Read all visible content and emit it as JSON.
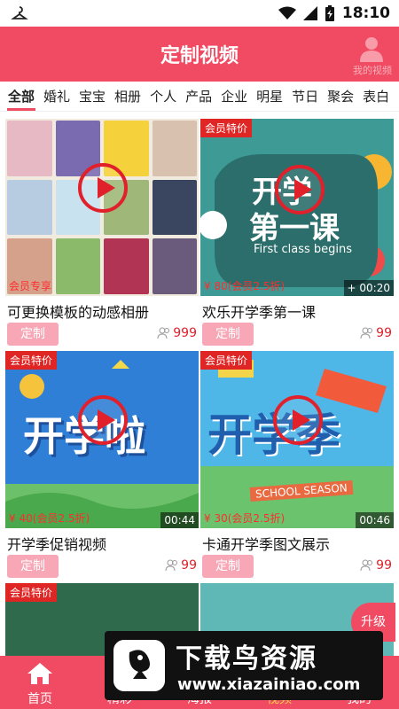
{
  "status_bar": {
    "time": "18:10"
  },
  "header": {
    "title": "定制视频",
    "mine_label": "我的视频"
  },
  "tabs": [
    "全部",
    "婚礼",
    "宝宝",
    "相册",
    "个人",
    "产品",
    "企业",
    "明星",
    "节日",
    "聚会",
    "表白"
  ],
  "cards": [
    {
      "title": "可更换模板的动感相册",
      "price": "会员专享",
      "make_label": "定制",
      "likes": "999",
      "badge": "",
      "duration": ""
    },
    {
      "title": "欢乐开学季第一课",
      "price": "¥ 80(会员2.5折)",
      "make_label": "定制",
      "likes": "99",
      "badge": "会员特价",
      "duration": "00:20",
      "thumb_text1": "开学",
      "thumb_text2": "第一课",
      "thumb_text3": "First class begins"
    },
    {
      "title": "开学季促销视频",
      "price": "¥ 40(会员2.5折)",
      "make_label": "定制",
      "likes": "99",
      "badge": "会员特价",
      "duration": "00:44",
      "thumb_text1": "开学啦"
    },
    {
      "title": "卡通开学季图文展示",
      "price": "¥ 30(会员2.5折)",
      "make_label": "定制",
      "likes": "99",
      "badge": "会员特价",
      "duration": "00:46",
      "thumb_text1": "开学季",
      "thumb_text2": "SCHOOL SEASON"
    },
    {
      "badge": "会员特价"
    }
  ],
  "upgrade_label": "升级",
  "bottom_nav": [
    {
      "label": "首页",
      "icon": "home-icon"
    },
    {
      "label": "精彩",
      "icon": "star-icon"
    },
    {
      "label": "海报",
      "icon": "image-icon"
    },
    {
      "label": "视频",
      "icon": "video-icon"
    },
    {
      "label": "我的",
      "icon": "user-icon"
    }
  ],
  "watermark": {
    "title": "下载鸟资源",
    "url": "www.xiazainiao.com"
  },
  "colors": {
    "brand": "#f04b62",
    "accent_red": "#e0202a",
    "button_pink": "#f7a7b5"
  }
}
